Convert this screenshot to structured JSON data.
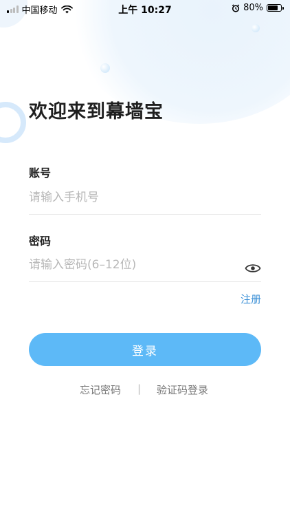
{
  "status_bar": {
    "carrier": "中国移动",
    "time": "上午 10:27",
    "battery_percent": "80%",
    "battery_level": 0.8,
    "icons": [
      "signal-icon",
      "wifi-icon",
      "alarm-clock-icon",
      "battery-icon"
    ]
  },
  "login": {
    "welcome_title": "欢迎来到幕墙宝",
    "account_label": "账号",
    "account_placeholder": "请输入手机号",
    "password_label": "密码",
    "password_placeholder": "请输入密码(6–12位)",
    "register_label": "注册",
    "submit_label": "登录",
    "forgot_password_label": "忘记密码",
    "separator": "|",
    "sms_login_label": "验证码登录"
  },
  "colors": {
    "primary_button": "#5db9f7",
    "link": "#3a8fd6",
    "placeholder": "#b7b7b7",
    "divider": "#e6e6e6"
  }
}
